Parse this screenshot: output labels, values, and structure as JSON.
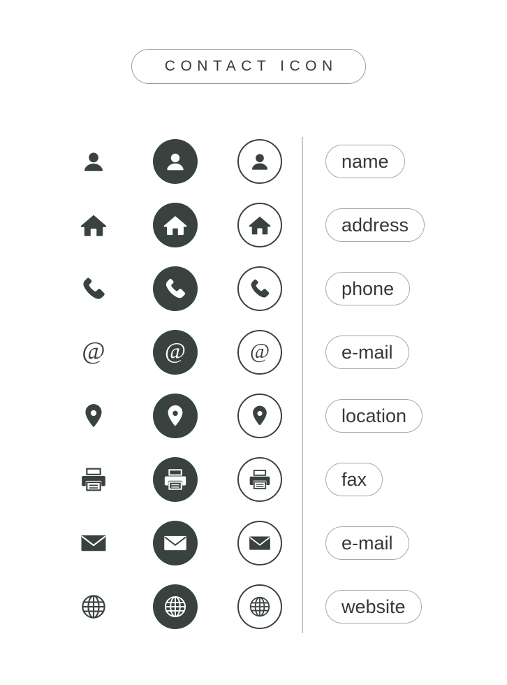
{
  "page": {
    "background": "#ffffff",
    "ink": "#3a423f",
    "pill_border": "#a8a8a8",
    "divider_color": "#c9c9c9"
  },
  "header": {
    "title": "CONTACT ICON"
  },
  "columns": [
    {
      "id": "plain",
      "style_label": "plain glyph"
    },
    {
      "id": "filled",
      "style_label": "filled circle"
    },
    {
      "id": "outline",
      "style_label": "outlined circle"
    }
  ],
  "rows": [
    {
      "icon": "person-icon",
      "label": "name"
    },
    {
      "icon": "home-icon",
      "label": "address"
    },
    {
      "icon": "phone-icon",
      "label": "phone"
    },
    {
      "icon": "at-sign-icon",
      "label": "e-mail"
    },
    {
      "icon": "location-icon",
      "label": "location"
    },
    {
      "icon": "printer-icon",
      "label": "fax"
    },
    {
      "icon": "envelope-icon",
      "label": "e-mail"
    },
    {
      "icon": "globe-icon",
      "label": "website"
    }
  ]
}
